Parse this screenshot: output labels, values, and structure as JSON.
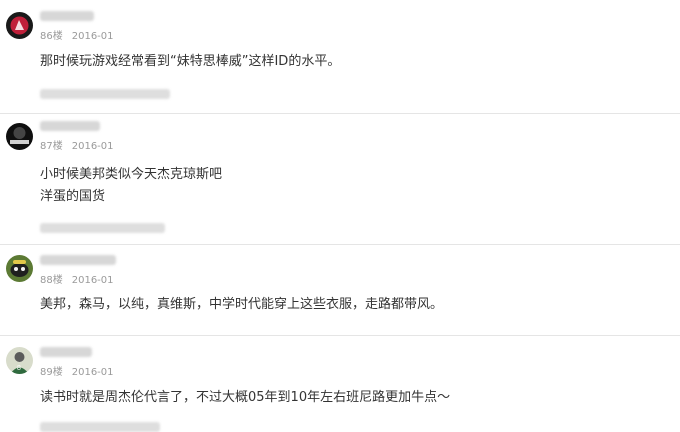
{
  "accent_colors": {
    "text": "#333333",
    "meta": "#9a9a9a",
    "divider": "#e5e5e5"
  },
  "comments": [
    {
      "floor": "86楼",
      "date": "2016-01",
      "lines": [
        "那时候玩游戏经常看到“妹特思棒威”这样ID的水平。"
      ],
      "avatar_icon": "red-sports-avatar-icon"
    },
    {
      "floor": "87楼",
      "date": "2016-01",
      "lines": [
        "小时候美邦类似今天杰克琼斯吧",
        "洋蛋的国货"
      ],
      "avatar_icon": "dark-avatar-icon"
    },
    {
      "floor": "88楼",
      "date": "2016-01",
      "lines": [
        "美邦，森马，以纯，真维斯，中学时代能穿上这些衣服，走路都带风。"
      ],
      "avatar_icon": "sheep-avatar-icon"
    },
    {
      "floor": "89楼",
      "date": "2016-01",
      "lines": [
        "读书时就是周杰伦代言了，不过大概05年到10年左右班尼路更加牛点～"
      ],
      "avatar_icon": "person-avatar-icon"
    }
  ]
}
